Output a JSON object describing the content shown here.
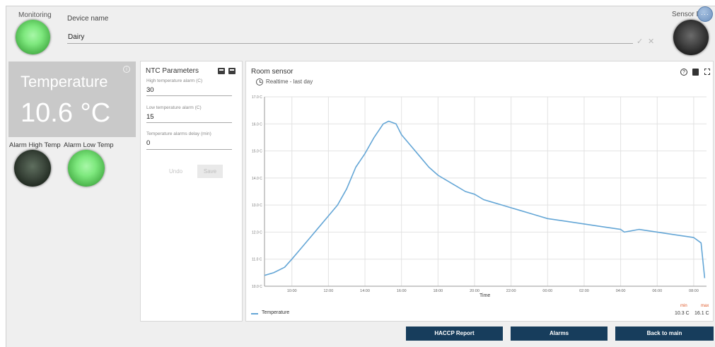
{
  "header": {
    "monitoring_label": "Monitoring",
    "device_name_label": "Device name",
    "device_name_value": "Dairy",
    "confirm_icon": "✓",
    "clear_icon": "✕",
    "sensor_error_label": "Sensor Error",
    "avatar_icon": "···"
  },
  "status": {
    "monitoring_led": "green",
    "sensor_error_led": "off",
    "alarm_high_led": "off",
    "alarm_low_led": "green"
  },
  "temperature": {
    "title": "Temperature",
    "value": "10.6 °C",
    "info_icon": "i"
  },
  "alarms": {
    "high_label": "Alarm High Temp",
    "low_label": "Alarm Low Temp"
  },
  "ntc": {
    "title": "NTC Parameters",
    "fields": [
      {
        "label": "High temperature alarm (C)",
        "value": "30"
      },
      {
        "label": "Low temperature alarm (C)",
        "value": "15"
      },
      {
        "label": "Temperature alarms delay (min)",
        "value": "0"
      }
    ],
    "undo_label": "Undo",
    "save_label": "Save"
  },
  "chart_panel": {
    "title": "Room sensor",
    "subtitle": "Realtime - last day",
    "help_icon": "?",
    "legend_label": "Temperature",
    "min_label": "min",
    "max_label": "max",
    "min_value": "10.3 C",
    "max_value": "16.1 C"
  },
  "chart_data": {
    "type": "line",
    "xlabel": "Time",
    "ylabel": "",
    "ylim": [
      10,
      17
    ],
    "yticks": [
      "10.0 C",
      "11.0 C",
      "12.0 C",
      "13.0 C",
      "14.0 C",
      "15.0 C",
      "16.0 C",
      "17.0 C"
    ],
    "xticks": [
      "10:00",
      "12:00",
      "14:00",
      "16:00",
      "18:00",
      "20:00",
      "22:00",
      "00:00",
      "02:00",
      "04:00",
      "06:00",
      "08:00"
    ],
    "xlim": [
      8.5,
      32.7
    ],
    "grid": true,
    "line_color": "#64a6d6",
    "series": [
      {
        "name": "Temperature",
        "x": [
          8.5,
          9.0,
          9.6,
          10.0,
          10.5,
          11.0,
          11.5,
          12.0,
          12.5,
          13.0,
          13.5,
          14.0,
          14.5,
          15.0,
          15.3,
          15.7,
          16.0,
          16.5,
          17.0,
          17.5,
          18.0,
          18.5,
          19.0,
          19.5,
          20.0,
          20.5,
          21.0,
          21.5,
          22.0,
          22.5,
          23.0,
          23.5,
          24.0,
          25.0,
          26.0,
          27.0,
          28.0,
          28.2,
          29.0,
          30.0,
          31.0,
          32.0,
          32.4,
          32.6
        ],
        "y": [
          10.4,
          10.5,
          10.7,
          11.0,
          11.4,
          11.8,
          12.2,
          12.6,
          13.0,
          13.6,
          14.4,
          14.9,
          15.5,
          16.0,
          16.1,
          16.0,
          15.6,
          15.2,
          14.8,
          14.4,
          14.1,
          13.9,
          13.7,
          13.5,
          13.4,
          13.2,
          13.1,
          13.0,
          12.9,
          12.8,
          12.7,
          12.6,
          12.5,
          12.4,
          12.3,
          12.2,
          12.1,
          12.0,
          12.1,
          12.0,
          11.9,
          11.8,
          11.6,
          10.3
        ]
      }
    ]
  },
  "buttons": {
    "haccp": "HACCP Report",
    "alarms": "Alarms",
    "back": "Back to main"
  }
}
